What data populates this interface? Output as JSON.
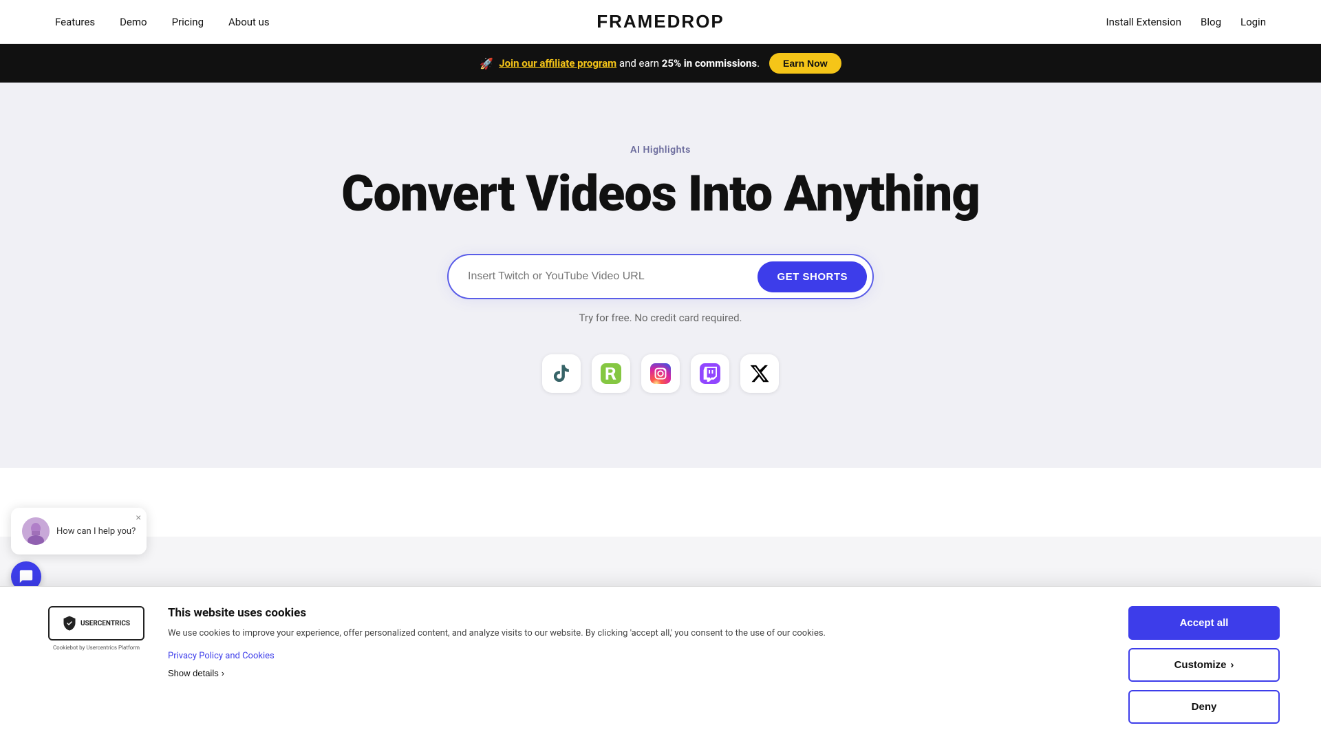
{
  "navbar": {
    "links": [
      {
        "label": "Features",
        "name": "nav-features"
      },
      {
        "label": "Demo",
        "name": "nav-demo"
      },
      {
        "label": "Pricing",
        "name": "nav-pricing"
      },
      {
        "label": "About us",
        "name": "nav-about"
      }
    ],
    "logo": "FRAMEDROP",
    "right_links": [
      {
        "label": "Install Extension",
        "name": "nav-install"
      },
      {
        "label": "Blog",
        "name": "nav-blog"
      },
      {
        "label": "Login",
        "name": "nav-login"
      }
    ]
  },
  "banner": {
    "rocket_emoji": "🚀",
    "affiliate_text": "Join our affiliate program",
    "and_earn_text": " and earn ",
    "commission_text": "25% in commissions",
    "period": ".",
    "earn_now_label": "Earn Now"
  },
  "hero": {
    "tag": "AI Highlights",
    "title": "Convert Videos Into Anything",
    "input_placeholder": "Insert Twitch or YouTube Video URL",
    "cta_label": "GET SHORTS",
    "sub_text": "Try for free. No credit card required.",
    "social_icons": [
      {
        "name": "tiktok",
        "label": "TikTok"
      },
      {
        "name": "rumble",
        "label": "Rumble"
      },
      {
        "name": "instagram",
        "label": "Instagram"
      },
      {
        "name": "twitch",
        "label": "Twitch"
      },
      {
        "name": "x-twitter",
        "label": "X / Twitter"
      }
    ]
  },
  "cookie": {
    "title": "This website uses cookies",
    "description": "We use cookies to improve your experience, offer personalized content, and analyze visits to our website. By clicking 'accept all,' you consent to the use of our cookies.",
    "policy_link": "Privacy Policy and Cookies",
    "show_details": "Show details",
    "accept_label": "Accept all",
    "customize_label": "Customize",
    "deny_label": "Deny",
    "usercentrics_text": "USERCENTRICS",
    "usercentrics_sub": "Cookiebot by Usercentrics Platform"
  },
  "chat": {
    "message": "How can I help you?",
    "close_icon": "×"
  },
  "colors": {
    "accent_blue": "#3d3dea",
    "banner_yellow": "#f5c518",
    "banner_bg": "#111111",
    "affiliate_link_color": "#f5c518"
  }
}
